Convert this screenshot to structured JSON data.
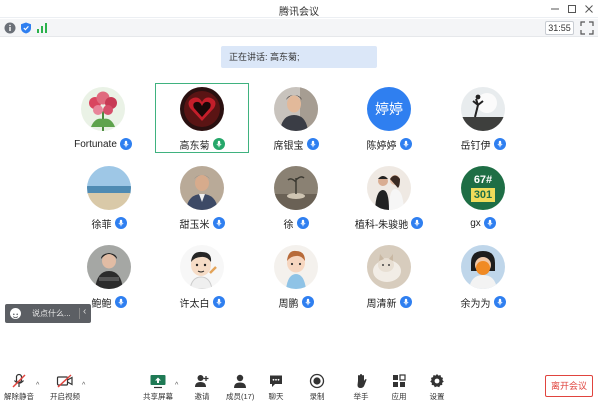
{
  "window": {
    "title": "腾讯会议"
  },
  "infobar": {
    "timer": "31:55"
  },
  "speaking": {
    "label": "正在讲话: 高东菊;"
  },
  "participants": [
    {
      "name": "Fortunate",
      "mic": "on"
    },
    {
      "name": "高东菊",
      "mic": "talking",
      "active": true
    },
    {
      "name": "席银宝",
      "mic": "on"
    },
    {
      "name": "陈婷婷",
      "mic": "on",
      "avatar_text": "婷婷"
    },
    {
      "name": "岳钉伊",
      "mic": "on"
    },
    {
      "name": "徐菲",
      "mic": "on"
    },
    {
      "name": "甜玉米",
      "mic": "on"
    },
    {
      "name": "徐",
      "mic": "on"
    },
    {
      "name": "植科-朱骏驰",
      "mic": "on"
    },
    {
      "name": "gx",
      "mic": "on",
      "avatar_text_top": "67#",
      "avatar_text_bottom": "301"
    },
    {
      "name": "鲍鲍",
      "mic": "on"
    },
    {
      "name": "许太白",
      "mic": "on"
    },
    {
      "name": "周鹏",
      "mic": "on"
    },
    {
      "name": "周清新",
      "mic": "on"
    },
    {
      "name": "余为为",
      "mic": "on"
    }
  ],
  "chat_popup": {
    "placeholder": "说点什么..."
  },
  "toolbar": {
    "unmute": "解除静音",
    "video": "开启视频",
    "share": "共享屏幕",
    "invite": "邀请",
    "members": "成员(17)",
    "chat": "聊天",
    "record": "录制",
    "raise_hand": "举手",
    "apps": "应用",
    "settings": "设置",
    "leave": "离开会议"
  },
  "colors": {
    "accent": "#2f7ff0",
    "talking": "#26a76a",
    "leave": "#e0443e",
    "active_border": "#3fb27f"
  }
}
